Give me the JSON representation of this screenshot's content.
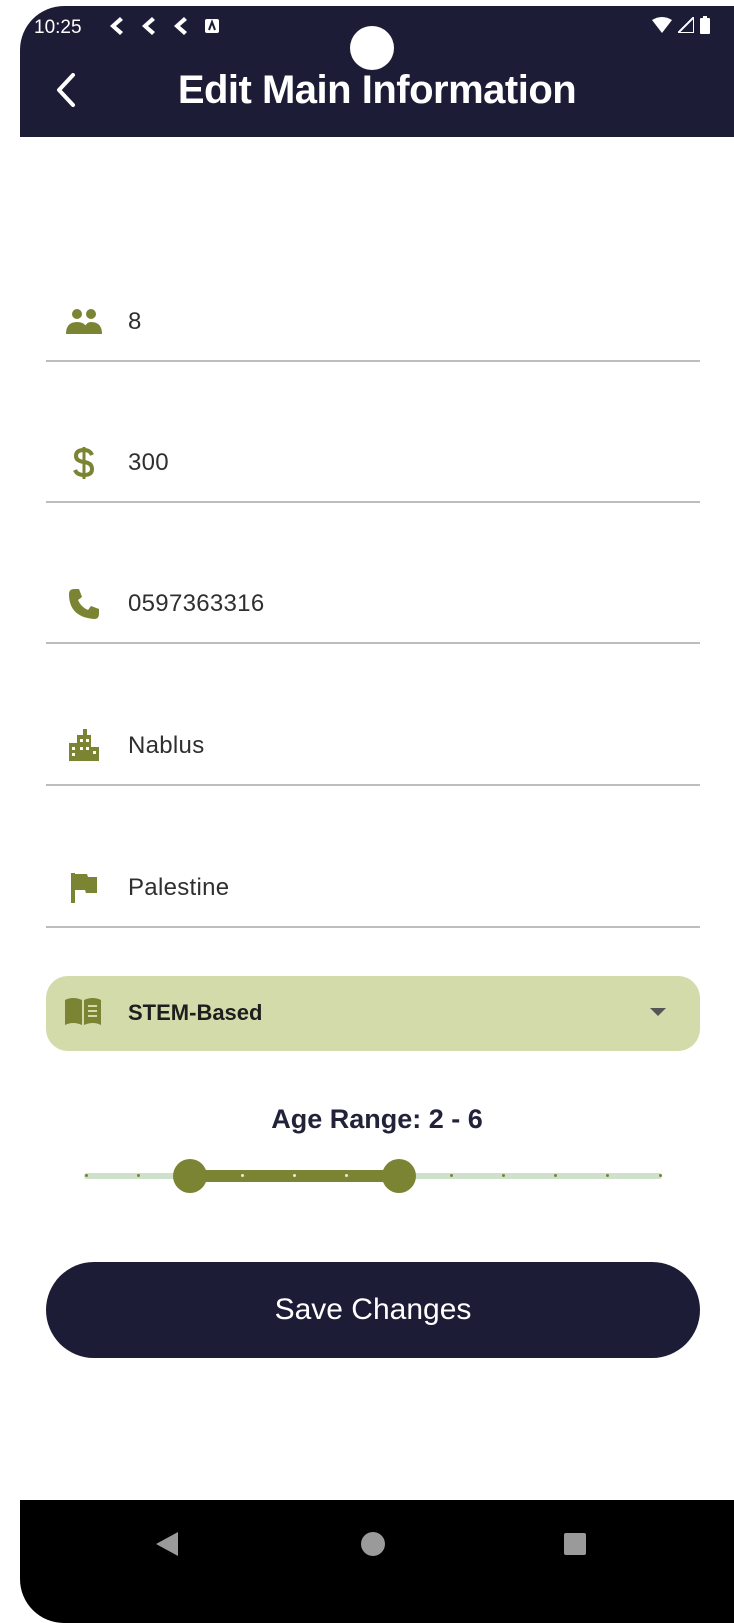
{
  "status_bar": {
    "time": "10:25"
  },
  "header": {
    "title": "Edit Main Information"
  },
  "fields": {
    "capacity": {
      "value": "8",
      "icon": "group-icon"
    },
    "price": {
      "value": "300",
      "icon": "dollar-icon"
    },
    "phone": {
      "value": "0597363316",
      "icon": "phone-icon"
    },
    "city": {
      "value": "Nablus",
      "icon": "city-icon"
    },
    "country": {
      "value": "Palestine",
      "icon": "flag-icon"
    }
  },
  "curriculum": {
    "selected": "STEM-Based",
    "icon": "book-icon"
  },
  "age_range": {
    "label": "Age Range: 2 - 6",
    "min": 0,
    "max": 11,
    "low": 2,
    "high": 6
  },
  "actions": {
    "save_label": "Save Changes"
  },
  "colors": {
    "primary": "#1c1c36",
    "accent": "#7a8433",
    "dropdown_bg": "#d3dbab"
  }
}
